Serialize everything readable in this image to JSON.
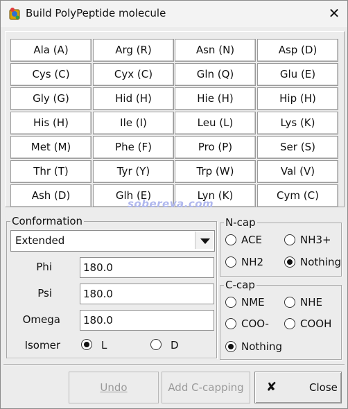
{
  "window": {
    "title": "Build PolyPeptide molecule",
    "close_glyph": "✕"
  },
  "amino_acids": [
    "Ala (A)",
    "Arg (R)",
    "Asn (N)",
    "Asp (D)",
    "Cys (C)",
    "Cyx (C)",
    "Gln (Q)",
    "Glu (E)",
    "Gly (G)",
    "Hid (H)",
    "Hie (H)",
    "Hip (H)",
    "His (H)",
    "Ile (I)",
    "Leu (L)",
    "Lys (K)",
    "Met (M)",
    "Phe (F)",
    "Pro (P)",
    "Ser (S)",
    "Thr (T)",
    "Tyr (Y)",
    "Trp (W)",
    "Val (V)",
    "Ash (D)",
    "Glh (E)",
    "Lyn (K)",
    "Cym (C)"
  ],
  "watermark": "sobereva.com",
  "conformation": {
    "title": "Conformation",
    "selected": "Extended",
    "phi": {
      "label": "Phi",
      "value": "180.0"
    },
    "psi": {
      "label": "Psi",
      "value": "180.0"
    },
    "omega": {
      "label": "Omega",
      "value": "180.0"
    },
    "isomer": {
      "label": "Isomer",
      "options": [
        "L",
        "D"
      ],
      "selected": "L"
    }
  },
  "ncap": {
    "title": "N-cap",
    "options": [
      "ACE",
      "NH3+",
      "NH2",
      "Nothing"
    ],
    "selected": "Nothing"
  },
  "ccap": {
    "title": "C-cap",
    "options": [
      "NME",
      "NHE",
      "COO-",
      "COOH",
      "Nothing"
    ],
    "selected": "Nothing"
  },
  "buttons": {
    "undo": "Undo",
    "add_ccapping": "Add C-capping",
    "close": "Close",
    "close_icon_glyph": "✘"
  }
}
